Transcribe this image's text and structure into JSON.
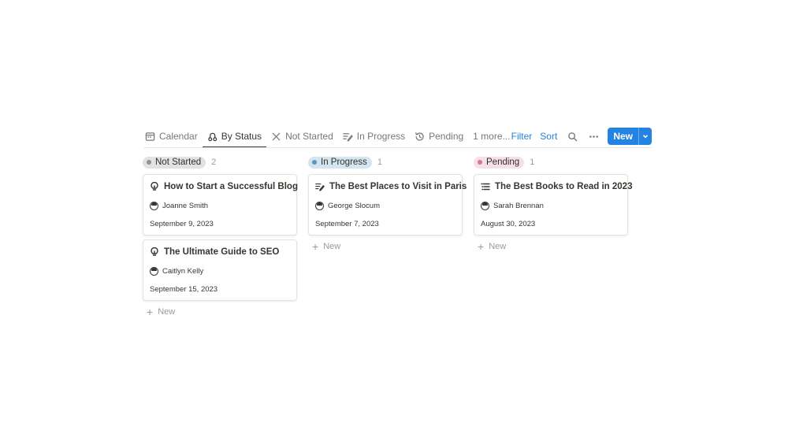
{
  "toolbar": {
    "tabs": [
      {
        "label": "Calendar",
        "icon": "calendar-icon"
      },
      {
        "label": "By Status",
        "icon": "status-icon"
      },
      {
        "label": "Not Started",
        "icon": "x-icon"
      },
      {
        "label": "In Progress",
        "icon": "edit-list-icon"
      },
      {
        "label": "Pending",
        "icon": "history-icon"
      }
    ],
    "active_tab": "By Status",
    "more_label": "1 more...",
    "filter_label": "Filter",
    "sort_label": "Sort",
    "new_label": "New"
  },
  "colors": {
    "accent": "#2383e2",
    "not_started_pill": "#e3e2e0",
    "not_started_dot": "#91918e",
    "in_progress_pill": "#d3e5ef",
    "in_progress_dot": "#5b97bd",
    "pending_pill": "#f5e0e9",
    "pending_dot": "#cd7b9e"
  },
  "board": {
    "columns": [
      {
        "label": "Not Started",
        "count": "2",
        "cards": [
          {
            "title": "How to Start a Successful Blog",
            "icon": "lightbulb-icon",
            "person": "Joanne Smith",
            "date": "September 9, 2023"
          },
          {
            "title": "The Ultimate Guide to SEO",
            "icon": "lightbulb-icon",
            "person": "Caitlyn Kelly",
            "date": "September 15, 2023"
          }
        ],
        "new_label": "New"
      },
      {
        "label": "In Progress",
        "count": "1",
        "cards": [
          {
            "title": "The Best Places to Visit in Paris",
            "icon": "edit-list-icon",
            "person": "George Slocum",
            "date": "September 7, 2023"
          }
        ],
        "new_label": "New"
      },
      {
        "label": "Pending",
        "count": "1",
        "cards": [
          {
            "title": "The Best Books to Read in 2023",
            "icon": "list-icon",
            "person": "Sarah Brennan",
            "date": "August 30, 2023"
          }
        ],
        "new_label": "New"
      }
    ]
  }
}
